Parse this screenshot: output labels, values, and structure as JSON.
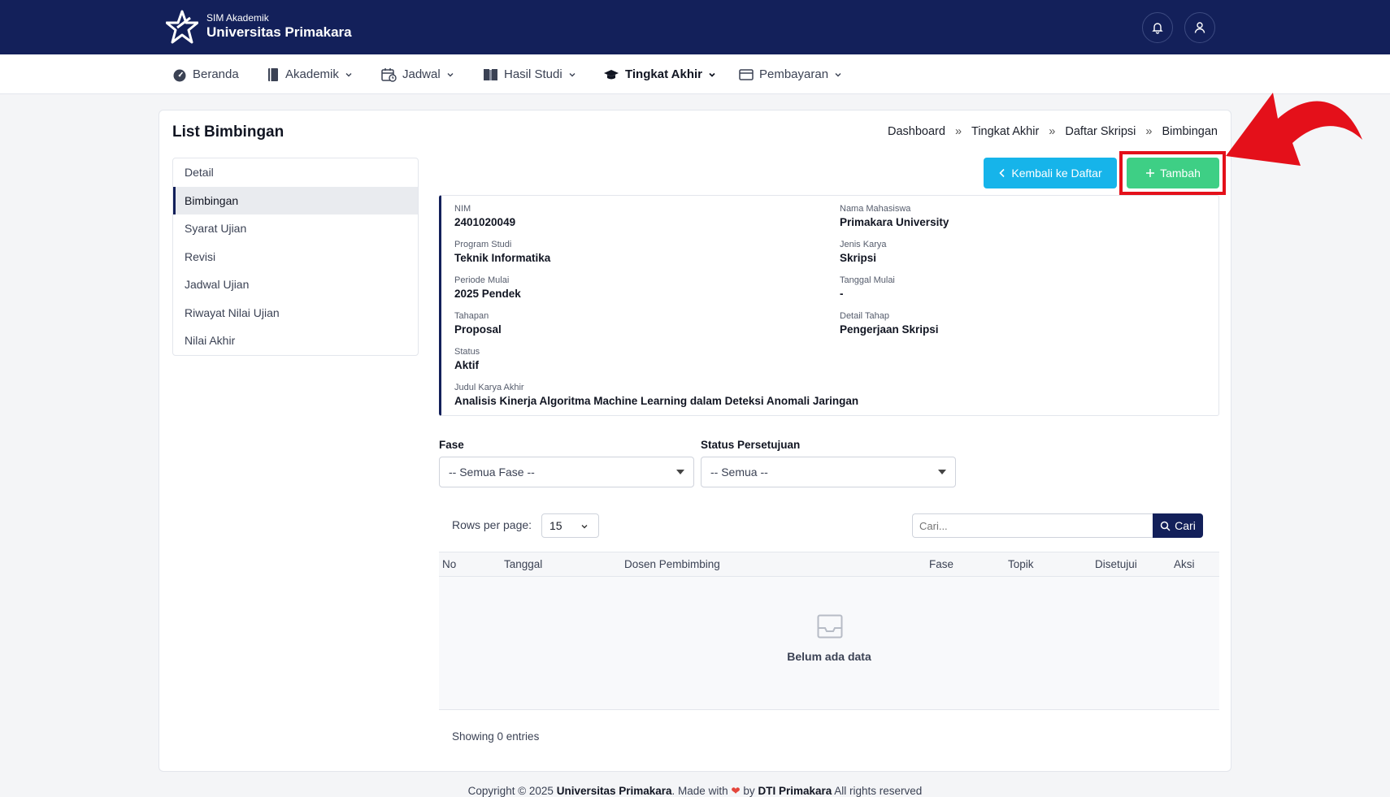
{
  "header": {
    "app_subtitle": "SIM Akademik",
    "app_title": "Universitas Primakara",
    "bell_icon": "bell-icon",
    "user_icon": "user-icon"
  },
  "nav": {
    "items": [
      {
        "label": "Beranda",
        "icon": "gauge-icon"
      },
      {
        "label": "Akademik",
        "icon": "book-icon"
      },
      {
        "label": "Jadwal",
        "icon": "calendar-clock-icon"
      },
      {
        "label": "Hasil Studi",
        "icon": "open-book-icon"
      },
      {
        "label": "Tingkat Akhir",
        "icon": "graduation-cap-icon"
      },
      {
        "label": "Pembayaran",
        "icon": "wallet-icon"
      }
    ]
  },
  "page": {
    "title": "List Bimbingan",
    "breadcrumb": [
      "Dashboard",
      "Tingkat Akhir",
      "Daftar Skripsi",
      "Bimbingan"
    ],
    "breadcrumb_sep": "»"
  },
  "side_menu": [
    "Detail",
    "Bimbingan",
    "Syarat Ujian",
    "Revisi",
    "Jadwal Ujian",
    "Riwayat Nilai Ujian",
    "Nilai Akhir"
  ],
  "actions": {
    "back_label": "Kembali ke Daftar",
    "add_label": "Tambah"
  },
  "info": {
    "nim": {
      "label": "NIM",
      "value": "2401020049"
    },
    "nama": {
      "label": "Nama Mahasiswa",
      "value": "Primakara University"
    },
    "prodi": {
      "label": "Program Studi",
      "value": "Teknik Informatika"
    },
    "jenis": {
      "label": "Jenis Karya",
      "value": "Skripsi"
    },
    "periode": {
      "label": "Periode Mulai",
      "value": "2025 Pendek"
    },
    "tanggal": {
      "label": "Tanggal Mulai",
      "value": "-"
    },
    "tahapan": {
      "label": "Tahapan",
      "value": "Proposal"
    },
    "detail_tahap": {
      "label": "Detail Tahap",
      "value": "Pengerjaan Skripsi"
    },
    "status": {
      "label": "Status",
      "value": "Aktif"
    },
    "judul": {
      "label": "Judul Karya Akhir",
      "value": "Analisis Kinerja Algoritma Machine Learning dalam Deteksi Anomali Jaringan"
    }
  },
  "filters": {
    "fase_label": "Fase",
    "fase_value": "-- Semua Fase --",
    "status_label": "Status Persetujuan",
    "status_value": "-- Semua --"
  },
  "table_controls": {
    "rows_label": "Rows per page:",
    "rows_value": "15",
    "search_placeholder": "Cari...",
    "search_button": "Cari"
  },
  "table": {
    "columns": [
      "No",
      "Tanggal",
      "Dosen Pembimbing",
      "Fase",
      "Topik",
      "Disetujui",
      "Aksi"
    ],
    "empty_text": "Belum ada data",
    "showing": "Showing 0 entries"
  },
  "footer": {
    "prefix": "Copyright © 2025",
    "org": "Universitas Primakara",
    "made_with": ". Made with",
    "by": "by",
    "team": "DTI Primakara",
    "suffix": "All rights reserved"
  },
  "colors": {
    "navy": "#13205a",
    "cyan": "#16b4ea",
    "green": "#3ecf85",
    "highlight_red": "#e4101a"
  }
}
